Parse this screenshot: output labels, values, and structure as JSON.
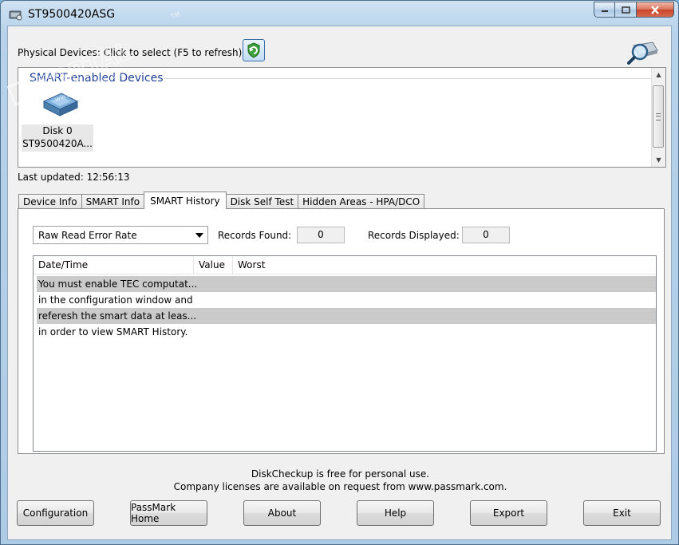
{
  "window": {
    "title": "ST9500420ASG"
  },
  "devices": {
    "label": "Physical Devices: Click to select (F5 to refresh)",
    "group_title": "SMART-enabled Devices",
    "items": [
      {
        "line1": "Disk 0",
        "line2": "ST9500420A..."
      }
    ]
  },
  "status": {
    "last_updated": "Last updated: 12:56:13"
  },
  "tabs": [
    {
      "label": "Device Info",
      "active": false
    },
    {
      "label": "SMART Info",
      "active": false
    },
    {
      "label": "SMART History",
      "active": true
    },
    {
      "label": "Disk Self Test",
      "active": false
    },
    {
      "label": "Hidden Areas - HPA/DCO",
      "active": false
    }
  ],
  "history": {
    "attribute_selected": "Raw Read Error Rate",
    "records_found_label": "Records Found:",
    "records_found": "0",
    "records_displayed_label": "Records Displayed:",
    "records_displayed": "0",
    "columns": [
      "Date/Time",
      "Value",
      "Worst"
    ],
    "rows": [
      {
        "text": "You must enable TEC computat...",
        "selected": true
      },
      {
        "text": "in the configuration window and",
        "selected": false
      },
      {
        "text": "referesh the smart data at leas...",
        "selected": true
      },
      {
        "text": "in order to view SMART History.",
        "selected": false
      }
    ]
  },
  "footer": {
    "line1": "DiskCheckup is free for personal use.",
    "line2": "Company licenses are available on request from www.passmark.com."
  },
  "buttons": {
    "configuration": "Configuration",
    "passmark_home": "PassMark Home",
    "about": "About",
    "help": "Help",
    "export": "Export",
    "exit": "Exit"
  },
  "watermark": {
    "text": "PORTAL",
    "url": "www.softportal.com",
    "tm": "TM"
  },
  "colors": {
    "group_title": "#1e3f94",
    "selected_row": "#cacaca",
    "title_bar": "#b7d2ea"
  }
}
